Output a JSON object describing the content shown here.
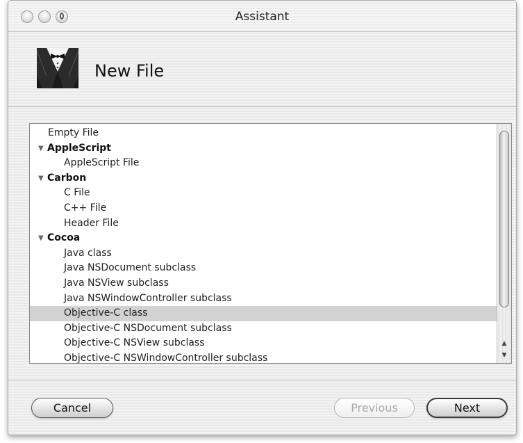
{
  "window": {
    "title": "Assistant"
  },
  "header": {
    "title": "New File",
    "icon": "tuxedo-icon"
  },
  "list": {
    "rows": [
      {
        "label": "Empty File",
        "kind": "top"
      },
      {
        "label": "AppleScript",
        "kind": "group"
      },
      {
        "label": "AppleScript File",
        "kind": "item"
      },
      {
        "label": "Carbon",
        "kind": "group"
      },
      {
        "label": "C File",
        "kind": "item"
      },
      {
        "label": "C++ File",
        "kind": "item"
      },
      {
        "label": "Header File",
        "kind": "item"
      },
      {
        "label": "Cocoa",
        "kind": "group"
      },
      {
        "label": "Java class",
        "kind": "item"
      },
      {
        "label": "Java NSDocument subclass",
        "kind": "item"
      },
      {
        "label": "Java NSView subclass",
        "kind": "item"
      },
      {
        "label": "Java NSWindowController subclass",
        "kind": "item"
      },
      {
        "label": "Objective-C class",
        "kind": "item",
        "selected": true
      },
      {
        "label": "Objective-C NSDocument subclass",
        "kind": "item"
      },
      {
        "label": "Objective-C NSView subclass",
        "kind": "item"
      },
      {
        "label": "Objective-C NSWindowController subclass",
        "kind": "item"
      }
    ],
    "disclosure_icon": "triangle-down-icon"
  },
  "buttons": {
    "cancel": "Cancel",
    "previous": "Previous",
    "next": "Next"
  },
  "colors": {
    "selected_row": "#d2d2d2",
    "disabled_text": "#a9a9a9"
  }
}
